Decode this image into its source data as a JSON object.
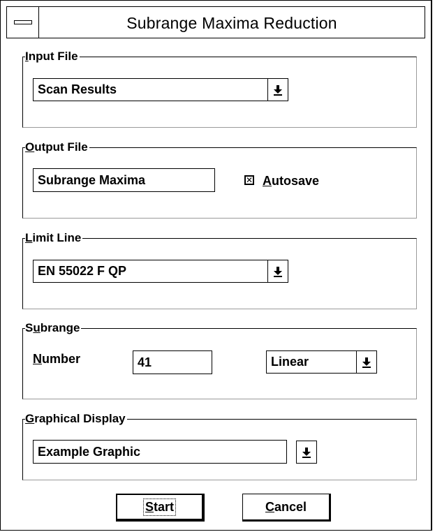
{
  "window": {
    "title": "Subrange Maxima Reduction"
  },
  "input_file": {
    "legend_u": "I",
    "legend_rest": "nput File",
    "value": "Scan Results",
    "icon": "dropdown-arrow-icon"
  },
  "output_file": {
    "legend_u": "O",
    "legend_rest": "utput File",
    "value": "Subrange Maxima",
    "autosave": {
      "checked": true,
      "mark": "✕",
      "label_u": "A",
      "label_rest": "utosave"
    }
  },
  "limit_line": {
    "legend_u": "L",
    "legend_rest": "imit Line",
    "value": "EN 55022 F QP"
  },
  "subrange": {
    "legend_pre": "S",
    "legend_u": "u",
    "legend_rest": "brange",
    "number_label_u": "N",
    "number_label_rest": "umber",
    "number_value": "41",
    "scale_value": "Linear"
  },
  "graphical_display": {
    "legend_u": "G",
    "legend_rest": "raphical Display",
    "value": "Example Graphic"
  },
  "buttons": {
    "start_u": "S",
    "start_rest": "tart",
    "cancel_u": "C",
    "cancel_rest": "ancel"
  }
}
